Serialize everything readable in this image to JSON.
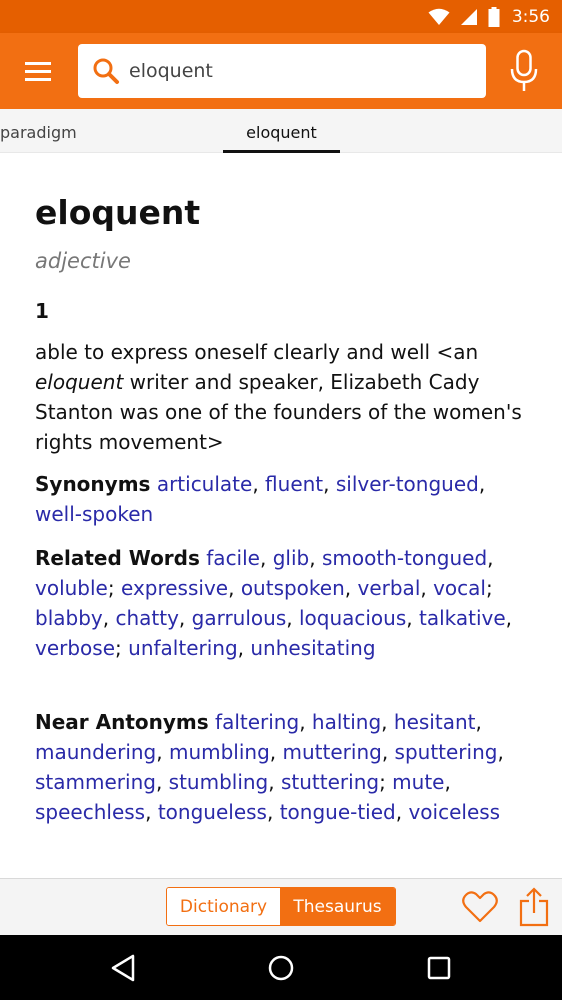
{
  "status_bar": {
    "time": "3:56",
    "icons": [
      "wifi-icon",
      "signal-icon",
      "battery-icon"
    ]
  },
  "app_bar": {
    "search_value": "eloquent",
    "menu_icon": "hamburger-menu-icon",
    "search_icon": "search-icon",
    "mic_icon": "microphone-icon",
    "color": "#f26f12"
  },
  "tabs": [
    {
      "label": "paradigm",
      "active": false
    },
    {
      "label": "eloquent",
      "active": true
    }
  ],
  "entry": {
    "headword": "eloquent",
    "part_of_speech": "adjective",
    "sense_number": "1",
    "definition_before": "able to express oneself clearly and well <an ",
    "definition_italic": "eloquent",
    "definition_after": " writer and speaker, Elizabeth Cady Stanton was one of the founders of the women's rights movement>",
    "synonyms_label": "Synonyms",
    "synonyms": [
      "articulate",
      "fluent",
      "silver-tongued",
      "well-spoken"
    ],
    "related_label": "Related Words",
    "related_groups": [
      [
        "facile",
        "glib",
        "smooth-tongued",
        "voluble"
      ],
      [
        "expressive",
        "outspoken",
        "verbal",
        "vocal"
      ],
      [
        "blabby",
        "chatty",
        "garrulous",
        "loquacious",
        "talkative",
        "verbose"
      ],
      [
        "unfaltering",
        "unhesitating"
      ]
    ],
    "antonyms_label": "Near Antonyms",
    "antonym_groups": [
      [
        "faltering",
        "halting",
        "hesitant",
        "maundering",
        "mumbling",
        "muttering",
        "sputtering",
        "stammering",
        "stumbling",
        "stuttering"
      ],
      [
        "mute",
        "speechless",
        "tongueless",
        "tongue-tied",
        "voiceless"
      ]
    ]
  },
  "bottom_bar": {
    "dictionary_label": "Dictionary",
    "thesaurus_label": "Thesaurus",
    "active": "Thesaurus",
    "favorite_icon": "heart-icon",
    "share_icon": "share-icon"
  },
  "nav_bar": {
    "icons": [
      "back-icon",
      "home-icon",
      "recent-apps-icon"
    ]
  },
  "colors": {
    "status_bar": "#e55f00",
    "accent": "#f26f12",
    "link": "#2a2aa8"
  }
}
